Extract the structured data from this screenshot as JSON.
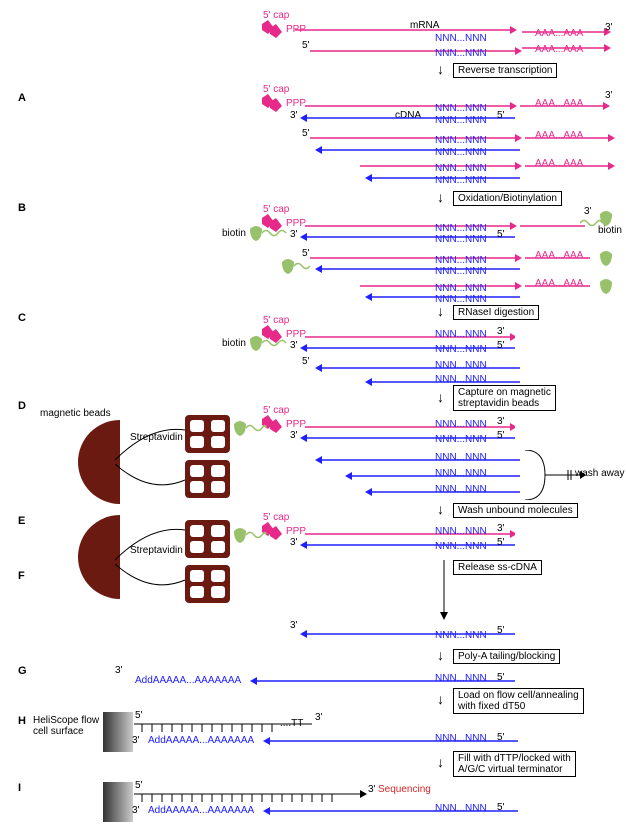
{
  "panels": {
    "A": "A",
    "B": "B",
    "C": "C",
    "D": "D",
    "E": "E",
    "F": "F",
    "G": "G",
    "H": "H",
    "I": "I"
  },
  "labels": {
    "five_cap": "5' cap",
    "five_prime": "5'",
    "three_prime": "3'",
    "mRNA": "mRNA",
    "cDNA": "cDNA",
    "PPP": "PPP",
    "NNN": "NNN...NNN",
    "polyA": "AAA...AAA",
    "biotin": "biotin",
    "magnetic_beads": "magnetic beads",
    "streptavidin": "Streptavidin",
    "wash_away": "wash away",
    "heliscope": "HeliScope flow\ncell surface",
    "sequencing": "Sequencing",
    "tailA": "AddAAAAA...AAAAAAA",
    "dTline": "....TT"
  },
  "steps": {
    "rev_trans": "Reverse transcription",
    "ox_biotin": "Oxidation/Biotinylation",
    "rnase": "RNaseI digestion",
    "capture": "Capture on magnetic\nstreptavidin beads",
    "wash": "Wash unbound molecules",
    "release": "Release ss-cDNA",
    "polyA_block": "Poly-A tailing/blocking",
    "load": "Load on flow cell/annealing\nwith fixed dT50",
    "fill": "Fill with dTTP/locked with\nA/G/C virtual terminator"
  }
}
